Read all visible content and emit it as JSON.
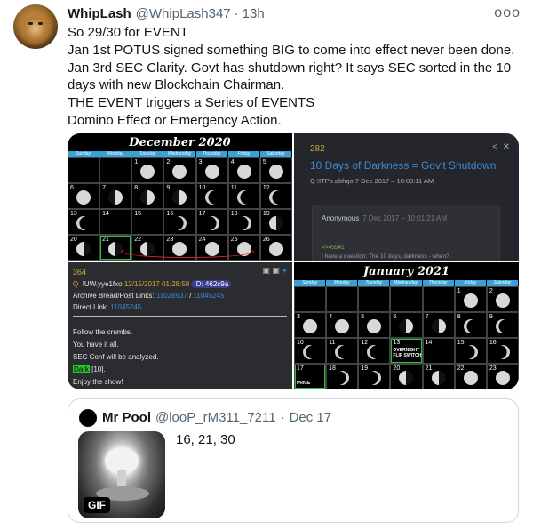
{
  "tweet": {
    "name": "WhipLash",
    "handle": "@WhipLash347",
    "separator": "·",
    "time": "13h",
    "more": "ooo",
    "lines": [
      "So 29/30 for EVENT",
      "Jan 1st POTUS signed something BIG to come into effect never been done.",
      "Jan 3rd SEC Clarity. Govt has shutdown right? It says SEC sorted in the 10",
      "days with new Blockchain Chairman.",
      "THE EVENT triggers a Series of EVENTS",
      "Domino Effect or Emergency Action."
    ]
  },
  "media": {
    "dec": {
      "title": "December 2020",
      "days": [
        "Sunday",
        "Monday",
        "Tuesday",
        "Wednesday",
        "Thursday",
        "Friday",
        "Saturday"
      ],
      "cells": [
        {
          "n": "",
          "m": ""
        },
        {
          "n": "",
          "m": ""
        },
        {
          "n": "1",
          "m": "full"
        },
        {
          "n": "2",
          "m": "full"
        },
        {
          "n": "3",
          "m": "full"
        },
        {
          "n": "4",
          "m": "full"
        },
        {
          "n": "5",
          "m": "full"
        },
        {
          "n": "6",
          "m": "full"
        },
        {
          "n": "7",
          "m": "half"
        },
        {
          "n": "8",
          "m": "half"
        },
        {
          "n": "9",
          "m": "half"
        },
        {
          "n": "10",
          "m": "crescent"
        },
        {
          "n": "11",
          "m": "crescent"
        },
        {
          "n": "12",
          "m": "crescent"
        },
        {
          "n": "13",
          "m": "crescent"
        },
        {
          "n": "14",
          "m": ""
        },
        {
          "n": "15",
          "m": ""
        },
        {
          "n": "16",
          "m": "crescentr"
        },
        {
          "n": "17",
          "m": "crescentr"
        },
        {
          "n": "18",
          "m": "crescentr"
        },
        {
          "n": "19",
          "m": "halfl"
        },
        {
          "n": "20",
          "m": "halfl"
        },
        {
          "n": "21",
          "m": "halfl"
        },
        {
          "n": "22",
          "m": "halfl"
        },
        {
          "n": "23",
          "m": "full"
        },
        {
          "n": "24",
          "m": "full"
        },
        {
          "n": "25",
          "m": "full"
        },
        {
          "n": "26",
          "m": "full"
        }
      ]
    },
    "qdark": {
      "count": "282",
      "title": "10 Days of Darkness = Gov't Shutdown",
      "meta": "Q  !ITPb.qbhqo  7 Dec 2017 – 10:03:11 AM",
      "anon": "Anonymous",
      "anon_time": "7 Dec 2017 – 10:01:21 AM",
      "reply": ">>45541",
      "text": "I have a question: The 10 days, darkness - when?"
    },
    "qpost": {
      "num": "364",
      "q": "Q",
      "trip": "!UW.yye1fxo",
      "date": "12/15/2017 01:28:58",
      "id": "ID: 462c9a",
      "archive_label": "Archive Bread/Post Links:",
      "archive_link1": "11028937",
      "archive_slash": "/",
      "archive_link2": "11045245",
      "direct_label": "Direct Link:",
      "direct_link": "11045245",
      "l1": "Follow the crumbs.",
      "l2": "You have it all.",
      "l3": "SEC Conf will be analyzed.",
      "dark": "Dark",
      "l4_rest": " [10].",
      "l5": "Enjoy the show!"
    },
    "jan": {
      "title": "January 2021",
      "days": [
        "Sunday",
        "Monday",
        "Tuesday",
        "Wednesday",
        "Thursday",
        "Friday",
        "Saturday"
      ],
      "cells": [
        {
          "n": "",
          "m": ""
        },
        {
          "n": "",
          "m": ""
        },
        {
          "n": "",
          "m": ""
        },
        {
          "n": "",
          "m": ""
        },
        {
          "n": "",
          "m": ""
        },
        {
          "n": "1",
          "m": "full"
        },
        {
          "n": "2",
          "m": "full"
        },
        {
          "n": "3",
          "m": "full"
        },
        {
          "n": "4",
          "m": "full"
        },
        {
          "n": "5",
          "m": "full"
        },
        {
          "n": "6",
          "m": "half"
        },
        {
          "n": "7",
          "m": "half"
        },
        {
          "n": "8",
          "m": "crescent"
        },
        {
          "n": "9",
          "m": "crescent"
        },
        {
          "n": "10",
          "m": "crescent"
        },
        {
          "n": "11",
          "m": "crescent"
        },
        {
          "n": "12",
          "m": "crescent"
        },
        {
          "n": "13",
          "m": ""
        },
        {
          "n": "14",
          "m": ""
        },
        {
          "n": "15",
          "m": "crescentr"
        },
        {
          "n": "16",
          "m": "crescentr"
        },
        {
          "n": "17",
          "m": ""
        },
        {
          "n": "18",
          "m": "crescentr"
        },
        {
          "n": "19",
          "m": "crescentr"
        },
        {
          "n": "20",
          "m": "halfl"
        },
        {
          "n": "21",
          "m": "halfl"
        },
        {
          "n": "22",
          "m": "full"
        },
        {
          "n": "23",
          "m": "full"
        }
      ],
      "note13": "OVERNIGHT FLIP SWITCH",
      "note17": "PRICE"
    }
  },
  "quote": {
    "name": "Mr Pool",
    "handle": "@looP_rM311_7211",
    "separator": "·",
    "time": "Dec 17",
    "text": "16, 21, 30",
    "gif_badge": "GIF"
  }
}
